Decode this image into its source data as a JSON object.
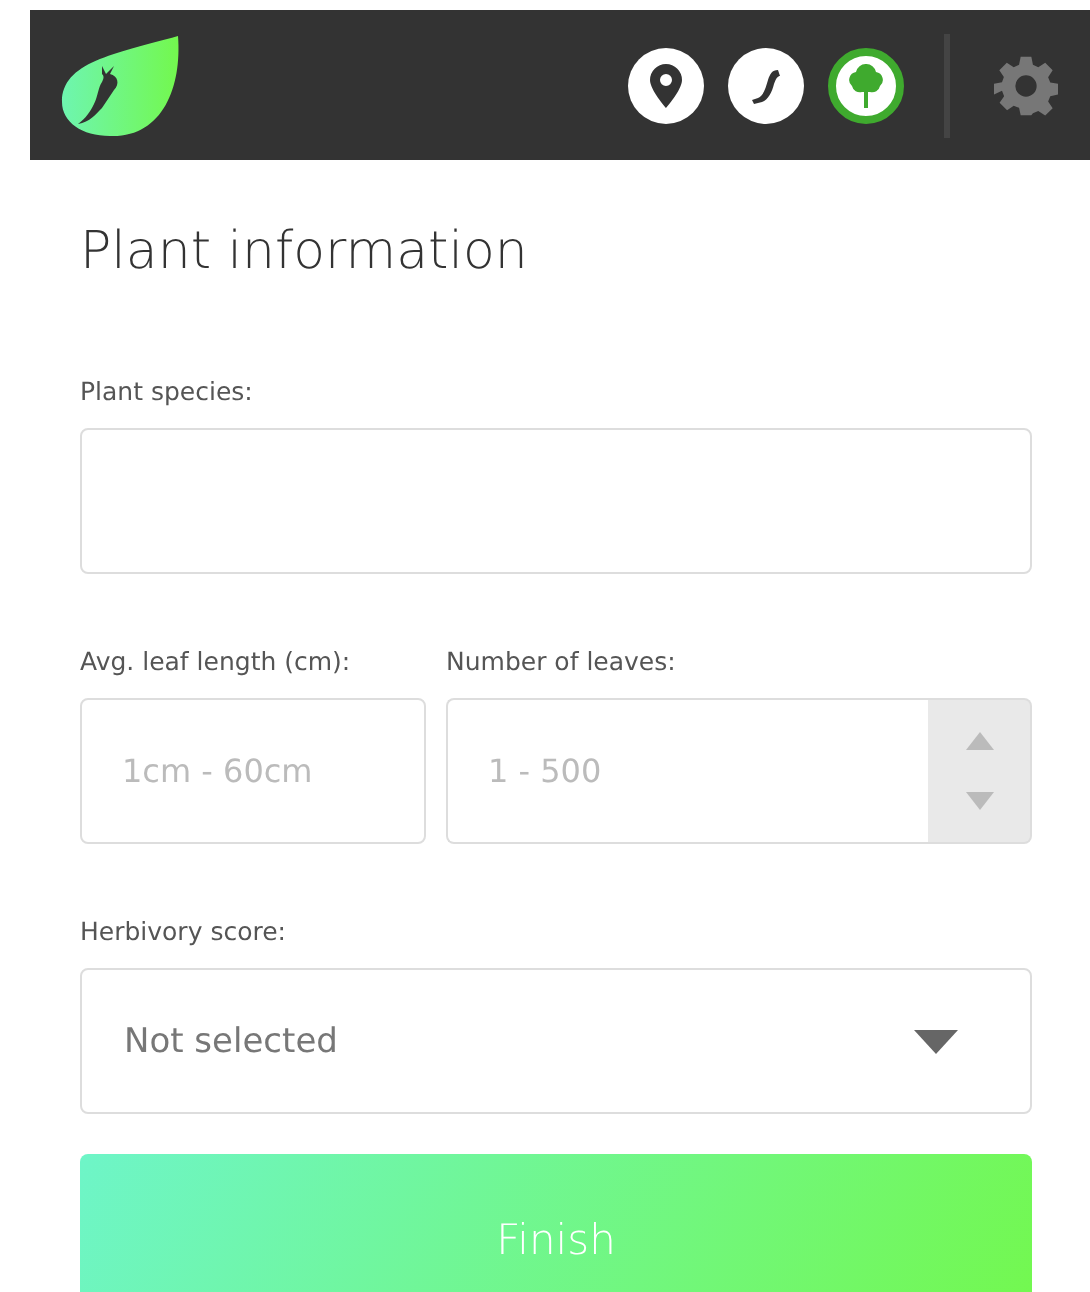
{
  "header": {
    "steps": [
      {
        "kind": "location",
        "selected": false
      },
      {
        "kind": "caterpillar",
        "selected": false
      },
      {
        "kind": "tree",
        "selected": true
      }
    ]
  },
  "title": "Plant information",
  "fields": [
    {
      "kind": "text",
      "label": "Plant species:"
    },
    {
      "kind": "number",
      "label": "Avg. leaf length (cm):",
      "placeholder": "1cm - 60cm"
    },
    {
      "kind": "spinner",
      "label": "Number of leaves:",
      "placeholder": "1 - 500"
    },
    {
      "kind": "select",
      "label": "Herbivory score:",
      "value": "Not selected"
    }
  ],
  "button": "Finish"
}
